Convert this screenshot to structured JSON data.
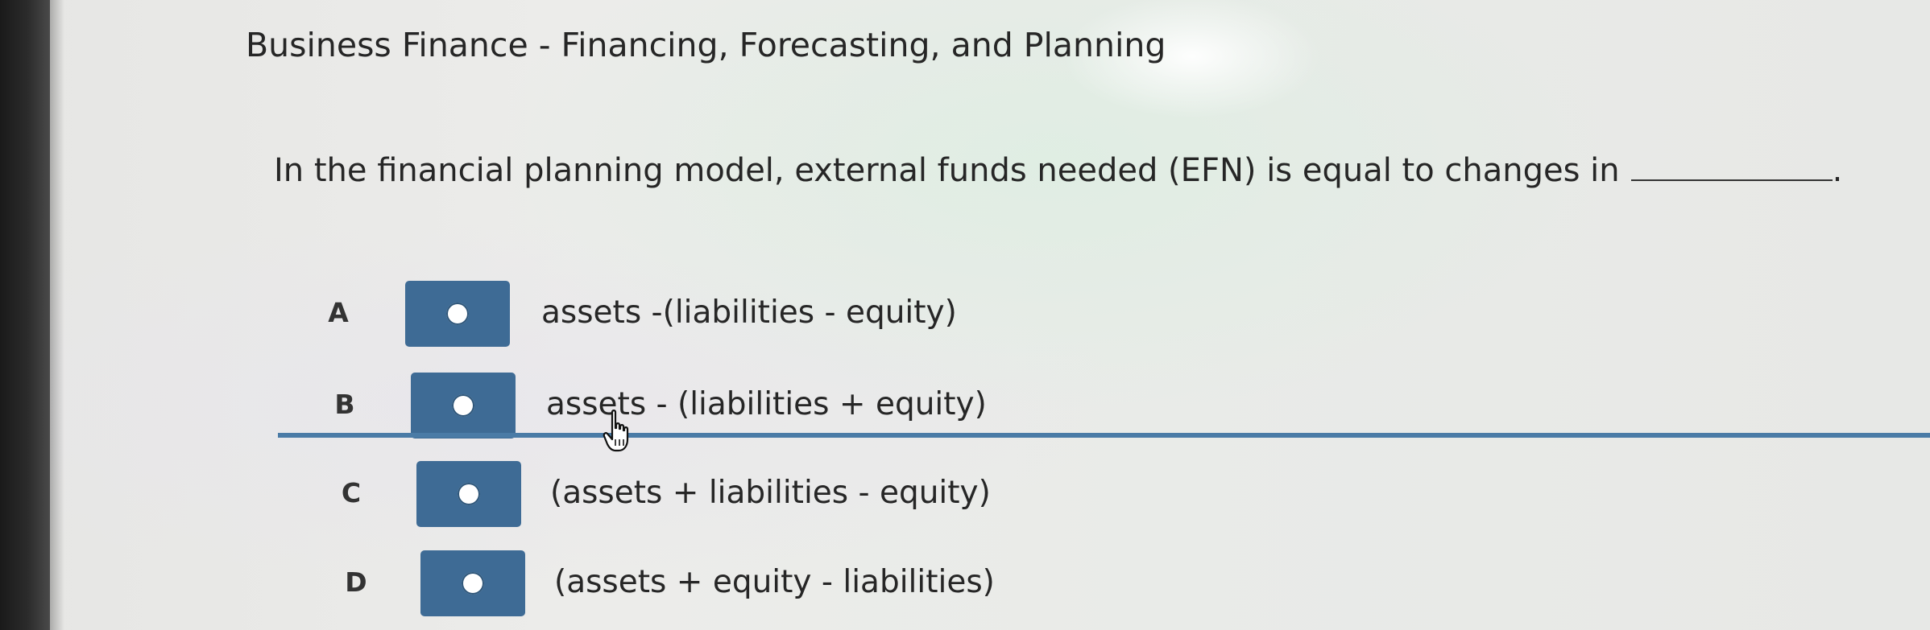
{
  "header": {
    "title": "Business Finance - Financing, Forecasting, and Planning"
  },
  "question": {
    "text": "In the financial planning model, external funds needed (EFN) is equal to changes in",
    "end_punctuation": "."
  },
  "options": [
    {
      "letter": "A",
      "text": "assets -(liabilities - equity)",
      "selected": false
    },
    {
      "letter": "B",
      "text": "assets - (liabilities + equity)",
      "selected": false
    },
    {
      "letter": "C",
      "text": "(assets + liabilities - equity)",
      "selected": false
    },
    {
      "letter": "D",
      "text": "(assets + equity - liabilities)",
      "selected": false
    }
  ],
  "colors": {
    "radio_button_bg": "#3e6b95",
    "divider": "#4a7ba6"
  },
  "icons": {
    "cursor": "hand-pointer-icon",
    "radio": "radio-circle-icon"
  }
}
